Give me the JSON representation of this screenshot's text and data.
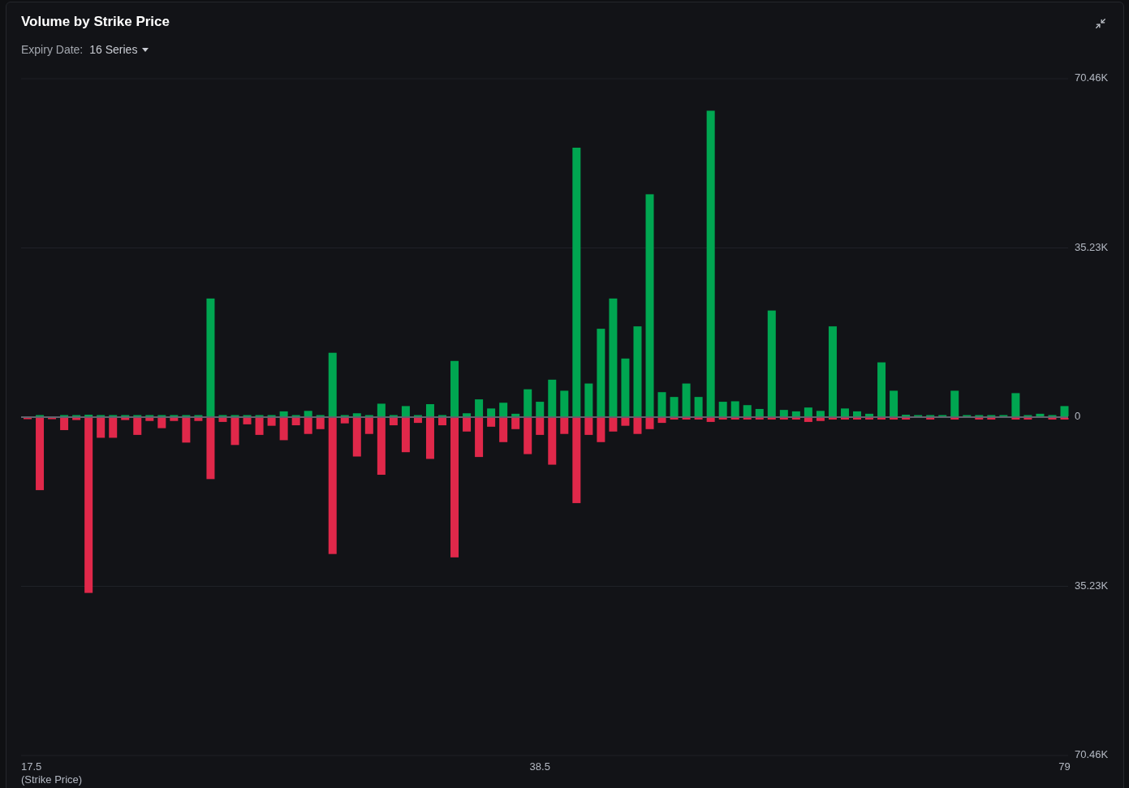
{
  "panel": {
    "title": "Volume by Strike Price",
    "expiry": {
      "label": "Expiry Date:",
      "value": "16 Series"
    },
    "chart_data": {
      "type": "bar",
      "xlabel": "(Strike Price)",
      "categories": [
        "17.5",
        null,
        null,
        null,
        null,
        null,
        null,
        null,
        null,
        null,
        null,
        null,
        null,
        null,
        null,
        null,
        null,
        null,
        null,
        null,
        null,
        null,
        null,
        null,
        null,
        null,
        null,
        null,
        null,
        null,
        null,
        null,
        null,
        null,
        null,
        null,
        null,
        null,
        null,
        null,
        null,
        null,
        "38.5",
        null,
        null,
        null,
        null,
        null,
        null,
        null,
        null,
        null,
        null,
        null,
        null,
        null,
        null,
        null,
        null,
        null,
        null,
        null,
        null,
        null,
        null,
        null,
        null,
        null,
        null,
        null,
        null,
        null,
        null,
        null,
        null,
        null,
        null,
        null,
        null,
        null,
        null,
        null,
        null,
        null,
        null,
        "79"
      ],
      "ylim": [
        -70460,
        70460
      ],
      "yticks": [
        {
          "value": 70460,
          "label": "70.46K"
        },
        {
          "value": 35230,
          "label": "35.23K"
        },
        {
          "value": 0,
          "label": "0"
        },
        {
          "value": -35230,
          "label": "35.23K"
        },
        {
          "value": -70460,
          "label": "70.46K"
        }
      ],
      "series": [
        {
          "color": "#00a651",
          "values": [
            0,
            300,
            0,
            300,
            300,
            500,
            300,
            300,
            300,
            300,
            300,
            300,
            300,
            300,
            300,
            24700,
            300,
            300,
            300,
            300,
            300,
            1200,
            300,
            1300,
            300,
            13400,
            300,
            800,
            300,
            2800,
            300,
            2300,
            300,
            2700,
            300,
            11700,
            800,
            3700,
            1800,
            3000,
            700,
            5800,
            3200,
            7800,
            5500,
            56100,
            7000,
            18400,
            24700,
            12200,
            18900,
            46400,
            5200,
            4200,
            7000,
            4200,
            63800,
            3200,
            3300,
            2500,
            1700,
            22200,
            1500,
            1200,
            2000,
            1300,
            18900,
            1800,
            1200,
            700,
            11400,
            5500,
            500,
            200,
            300,
            200,
            5500,
            200,
            300,
            200,
            200,
            5000,
            200,
            700,
            200,
            2300
          ]
        },
        {
          "color": "#e0284a",
          "values": [
            -300,
            -15200,
            -400,
            -2700,
            -600,
            -36600,
            -4300,
            -4300,
            -600,
            -3700,
            -800,
            -2300,
            -800,
            -5300,
            -800,
            -12900,
            -1000,
            -5800,
            -1500,
            -3700,
            -1800,
            -4800,
            -1700,
            -3500,
            -2500,
            -28500,
            -1300,
            -8200,
            -3500,
            -12000,
            -1700,
            -7300,
            -1200,
            -8700,
            -1700,
            -29200,
            -3000,
            -8300,
            -2000,
            -5200,
            -2500,
            -7700,
            -3700,
            -9900,
            -3500,
            -17900,
            -3700,
            -5200,
            -3000,
            -1800,
            -3500,
            -2500,
            -1200,
            -500,
            -500,
            -500,
            -1000,
            -500,
            -500,
            -500,
            -500,
            -500,
            -500,
            -500,
            -1000,
            -800,
            -500,
            -500,
            -500,
            -500,
            -500,
            -500,
            -500,
            0,
            -500,
            0,
            -500,
            0,
            -500,
            -500,
            0,
            -500,
            -500,
            0,
            -500,
            -500
          ]
        }
      ]
    }
  }
}
